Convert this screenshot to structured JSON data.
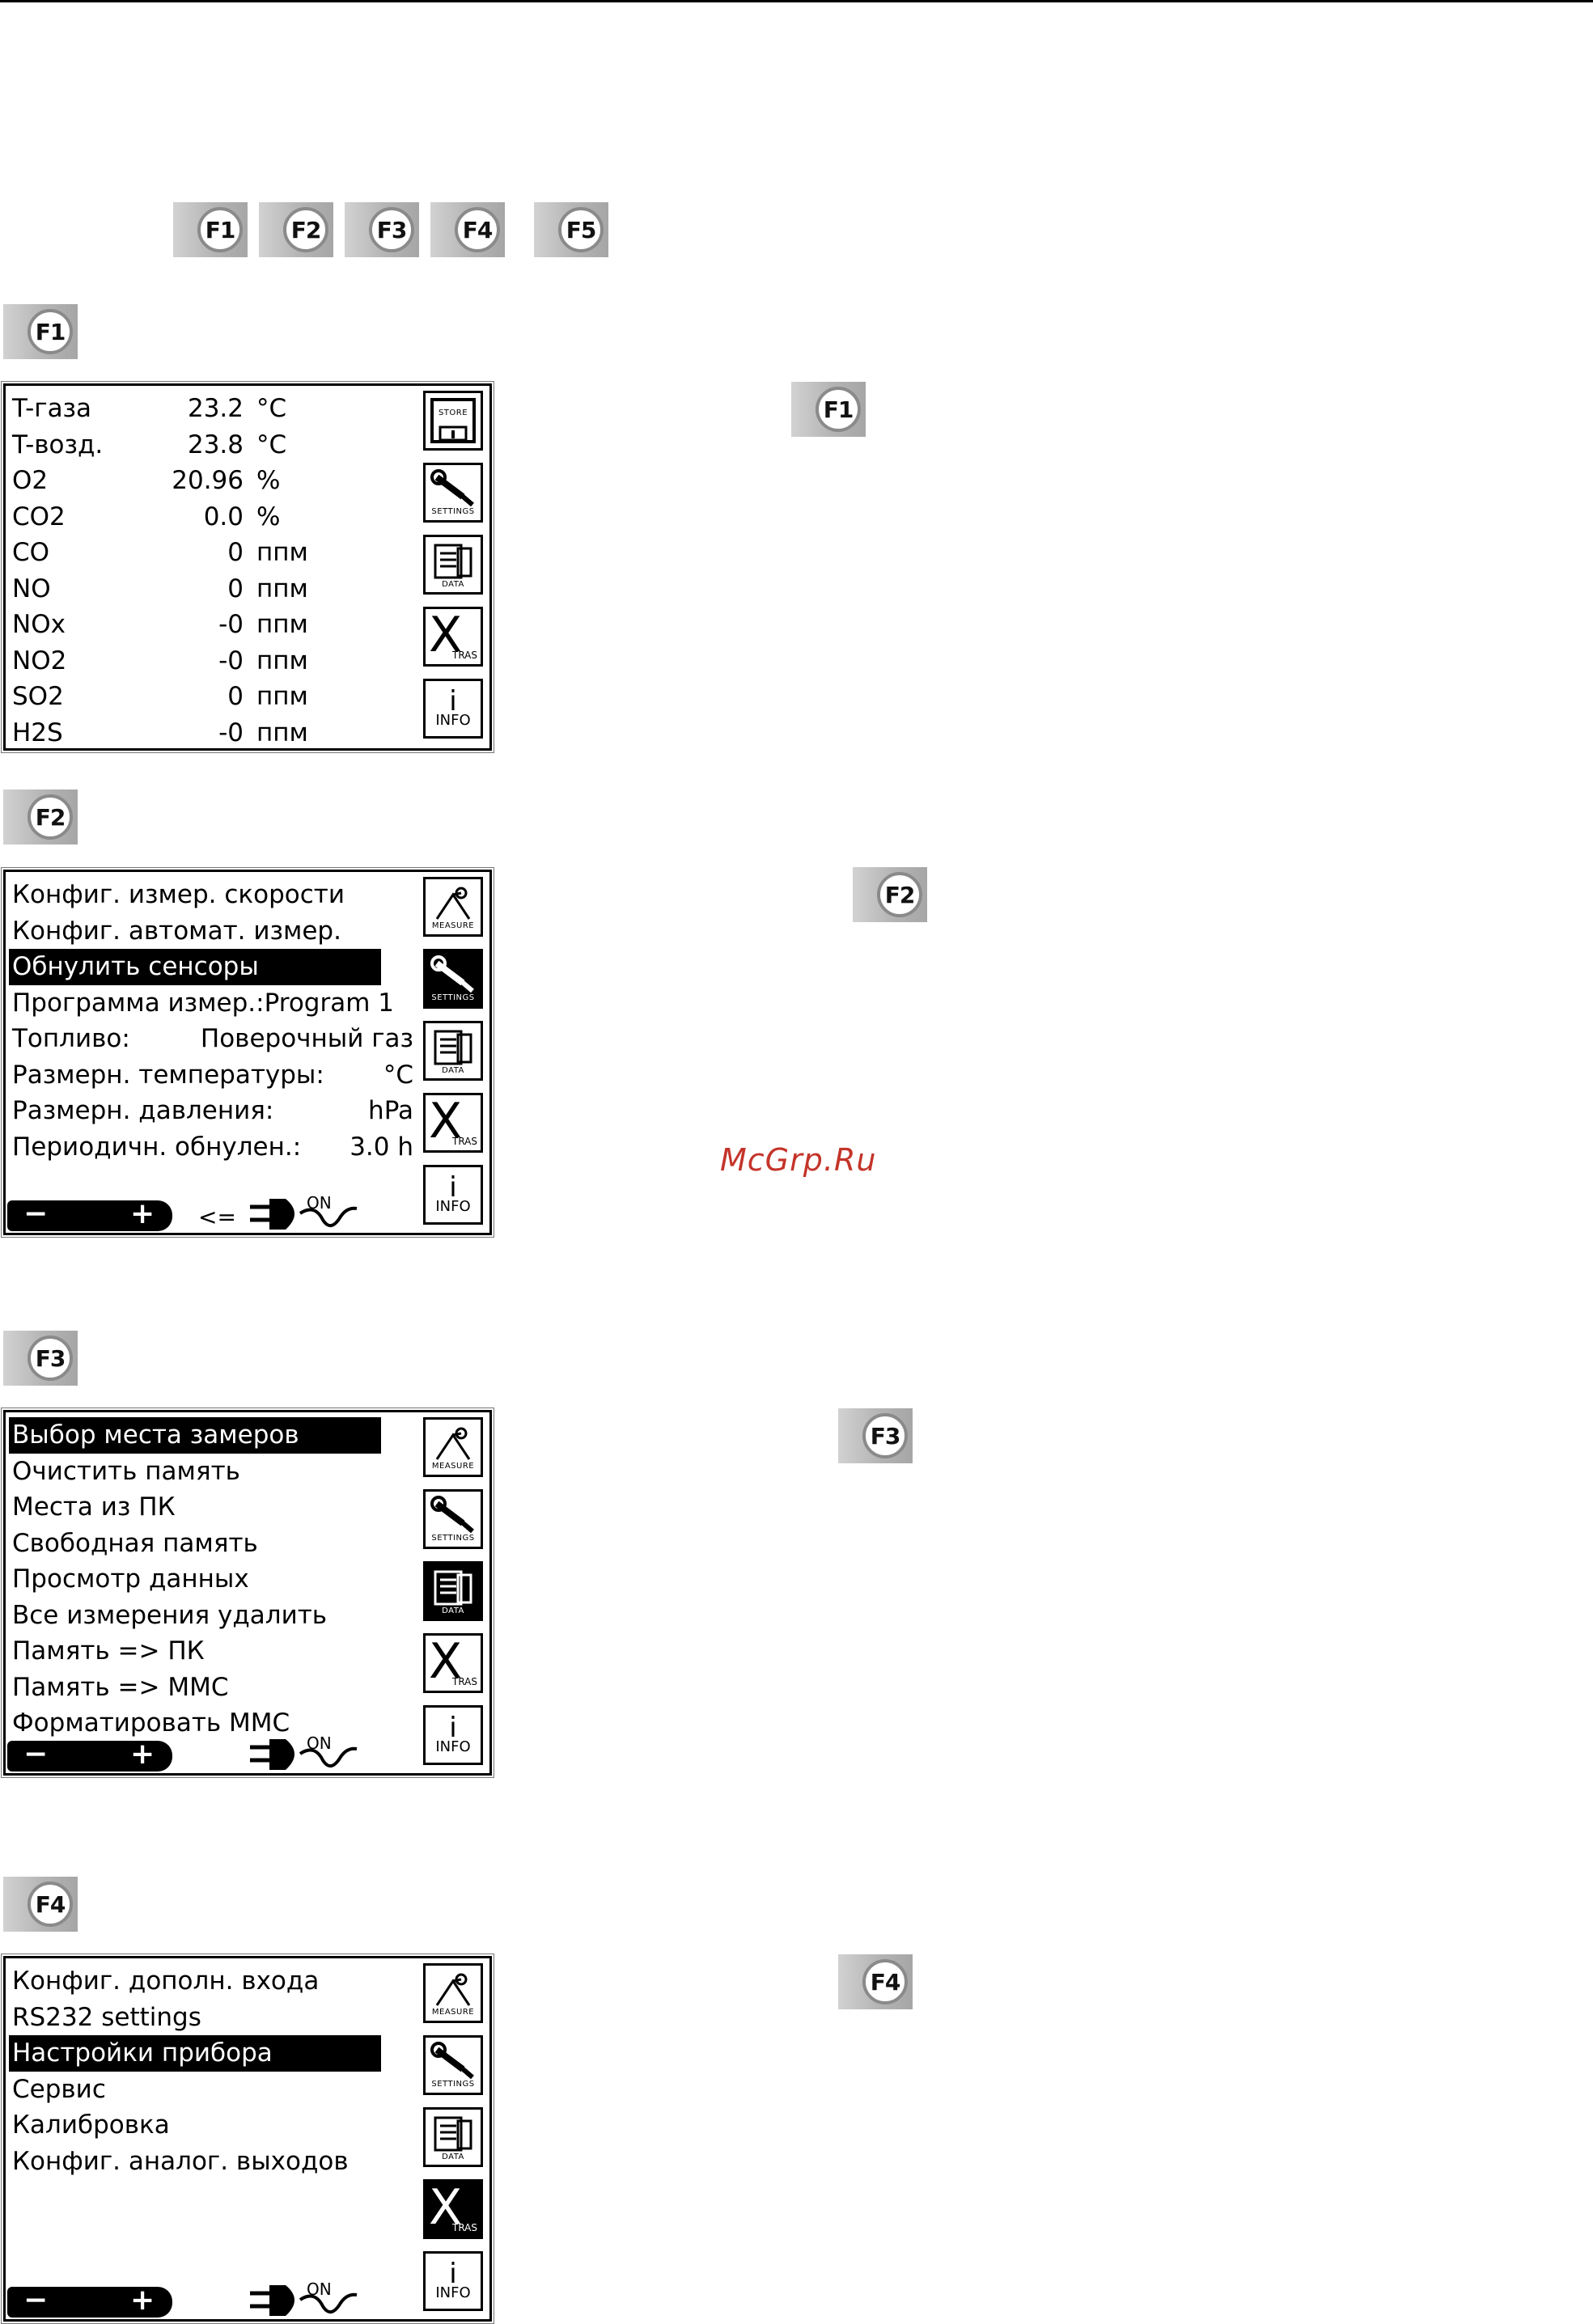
{
  "top_keys": [
    "F1",
    "F2",
    "F3",
    "F4",
    "F5"
  ],
  "sections": {
    "f1": {
      "key": "F1",
      "side_key": "F1",
      "rows": [
        {
          "name": "T-газа",
          "value": "23.2",
          "unit": "°C"
        },
        {
          "name": "T-возд.",
          "value": "23.8",
          "unit": "°C"
        },
        {
          "name": "O2",
          "value": "20.96",
          "unit": "%"
        },
        {
          "name": "CO2",
          "value": "0.0",
          "unit": "%"
        },
        {
          "name": "CO",
          "value": "0",
          "unit": "ппм"
        },
        {
          "name": "NO",
          "value": "0",
          "unit": "ппм"
        },
        {
          "name": "NOx",
          "value": "-0",
          "unit": "ппм"
        },
        {
          "name": "NO2",
          "value": "-0",
          "unit": "ппм"
        },
        {
          "name": "SO2",
          "value": "0",
          "unit": "ппм"
        },
        {
          "name": "H2S",
          "value": "-0",
          "unit": "ппм"
        }
      ],
      "icons": [
        "STORE",
        "SETTINGS",
        "DATA",
        "TRAS",
        "INFO"
      ]
    },
    "f2": {
      "key": "F2",
      "side_key": "F2",
      "rows": [
        {
          "label": "Конфиг. измер. скорости",
          "value": ""
        },
        {
          "label": "Конфиг. автомат. измер.",
          "value": ""
        },
        {
          "label": "Обнулить сенсоры",
          "value": ""
        },
        {
          "label": "Программа измер.:Program 1",
          "value": ""
        },
        {
          "label": "Топливо:",
          "value": "Поверочный газ"
        },
        {
          "label": "Размерн. температуры:",
          "value": "°C"
        },
        {
          "label": "Размерн. давления:",
          "value": "hPa"
        },
        {
          "label": "Периодичн. обнулен.:",
          "value": "3.0 h"
        }
      ],
      "minus": "−",
      "plus": "+",
      "arrow": "<=",
      "on_label": "ON",
      "icons": [
        "MEASURE",
        "SETTINGS",
        "DATA",
        "TRAS",
        "INFO"
      ]
    },
    "f3": {
      "key": "F3",
      "side_key": "F3",
      "rows": [
        "Выбор места замеров",
        "Очистить память",
        "Места из ПК",
        "Свободная память",
        "Просмотр данных",
        "Все измерения удалить",
        "Память => ПК",
        "Память => MMC",
        "Форматировать MMC"
      ],
      "minus": "−",
      "plus": "+",
      "on_label": "ON",
      "icons": [
        "MEASURE",
        "SETTINGS",
        "DATA",
        "TRAS",
        "INFO"
      ]
    },
    "f4": {
      "key": "F4",
      "side_key": "F4",
      "rows": [
        "Конфиг. дополн. входа",
        "RS232 settings",
        "Настройки прибора",
        "Сервис",
        "Калибровка",
        "Конфиг. аналог. выходов"
      ],
      "minus": "−",
      "plus": "+",
      "on_label": "ON",
      "icons": [
        "MEASURE",
        "SETTINGS",
        "DATA",
        "TRAS",
        "INFO"
      ]
    }
  },
  "info_text": "i",
  "x_text": "X",
  "watermark": "McGrp.Ru"
}
